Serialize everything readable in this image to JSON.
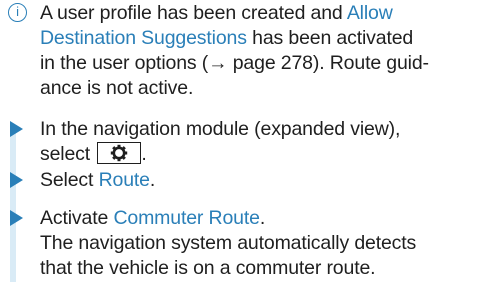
{
  "info": {
    "icon": "info-icon",
    "icon_glyph": "i",
    "text_1": "A user profile has been created and ",
    "link_1": "Allow",
    "link_2": "Destination Suggestions",
    "text_2": " has been activated",
    "text_3": "in the user options (→ page 278). Route guid-",
    "text_4": "ance is not active."
  },
  "steps": [
    {
      "icon": "arrow-right-icon",
      "line_1": "In the navigation module (expanded view),",
      "line_2": "select",
      "button_icon": "gear-icon",
      "after_button": "."
    },
    {
      "icon": "arrow-right-icon",
      "prefix": "Select ",
      "link": "Route",
      "suffix": "."
    },
    {
      "icon": "arrow-right-icon",
      "prefix": "Activate ",
      "link": "Commuter Route",
      "suffix": ".",
      "result_1": "The navigation system automatically detects",
      "result_2": "that the vehicle is on a commuter route."
    }
  ],
  "colors": {
    "accent": "#2a7fb8",
    "bar": "#d9ebf6",
    "text": "#1f1f1f"
  }
}
